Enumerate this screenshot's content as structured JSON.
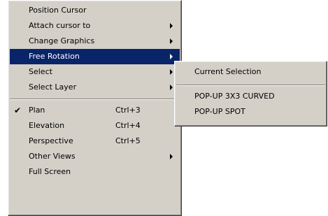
{
  "main_menu": {
    "items": [
      {
        "label": "Position Cursor"
      },
      {
        "label": "Attach cursor to"
      },
      {
        "label": "Change Graphics"
      },
      {
        "label": "Free Rotation"
      },
      {
        "label": "Select"
      },
      {
        "label": "Select Layer"
      },
      {
        "label": "Plan",
        "shortcut": "Ctrl+3",
        "checked": true
      },
      {
        "label": "Elevation",
        "shortcut": "Ctrl+4"
      },
      {
        "label": "Perspective",
        "shortcut": "Ctrl+5"
      },
      {
        "label": "Other Views"
      },
      {
        "label": "Full Screen"
      }
    ],
    "highlighted_item": "Free Rotation",
    "check_glyph": "✔"
  },
  "sub_menu": {
    "items": [
      {
        "label": "Current Selection"
      },
      {
        "label": "POP-UP 3X3 CURVED"
      },
      {
        "label": "POP-UP SPOT"
      }
    ]
  },
  "colors": {
    "menu_bg": "#d4d0c8",
    "highlight_bg": "#0a246a",
    "highlight_text": "#ffffff"
  }
}
